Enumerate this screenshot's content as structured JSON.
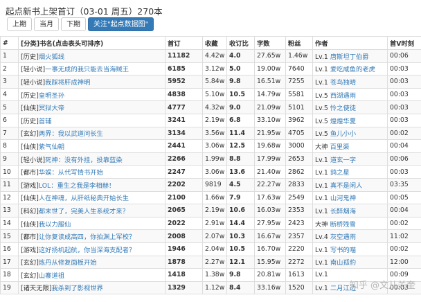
{
  "page": {
    "title": "起点新书上架首订（03-01 周五）270本",
    "buttons": [
      "上期",
      "当月",
      "下期",
      "关注\"起点数据图\""
    ]
  },
  "table": {
    "headers": [
      "#",
      "[分类]书名(点击表头可排序)",
      "首订",
      "收藏",
      "收订比",
      "字数",
      "粉丝",
      "作者",
      "首V时刻"
    ],
    "rows": [
      [
        "1",
        "[历史]",
        "烟火狐线",
        "11182",
        "4.42w",
        "4.0",
        "27.65w",
        "1.46w",
        "Lv.1",
        "唐斯坦丁伯爵",
        "00:06"
      ],
      [
        "2",
        "[轻小说]",
        "一事无成的我只能去当海贼王",
        "6185",
        "3.12w",
        "5.0",
        "19.00w",
        "7640",
        "Lv.1",
        "爱吃咸鱼的老虎",
        "00:03"
      ],
      [
        "3",
        "[轻小说]",
        "我踩将肝成神明",
        "5952",
        "5.84w",
        "9.8",
        "16.51w",
        "7255",
        "Lv.1",
        "苍鸟独晴",
        "00:03"
      ],
      [
        "4",
        "[历史]",
        "皇明圣孙",
        "4838",
        "5.10w",
        "10.5",
        "14.79w",
        "5581",
        "Lv.5",
        "西湖遇雨",
        "00:03"
      ],
      [
        "5",
        "[仙侠]",
        "冥狱大帝",
        "4777",
        "4.32w",
        "9.0",
        "21.09w",
        "5101",
        "Lv.5",
        "怜之使徒",
        "00:03"
      ],
      [
        "6",
        "[历史]",
        "首辅",
        "3241",
        "2.19w",
        "6.8",
        "33.10w",
        "3962",
        "Lv.5",
        "煌煌华夏",
        "00:03"
      ],
      [
        "7",
        "[玄幻]",
        "两界：我以武道问长生",
        "3134",
        "3.56w",
        "11.4",
        "21.95w",
        "4705",
        "Lv.5",
        "鱼儿小小",
        "00:02"
      ],
      [
        "8",
        "[仙侠]",
        "紫气仙朝",
        "2441",
        "3.06w",
        "12.5",
        "19.68w",
        "3000",
        "大神",
        "百里渠",
        "00:04"
      ],
      [
        "9",
        "[轻小说]",
        "死神：没有外挂，投靠蓝染",
        "2266",
        "1.99w",
        "8.8",
        "17.99w",
        "2653",
        "Lv.1",
        "道玄一字",
        "00:06"
      ],
      [
        "10",
        "[都市]",
        "华娱：从代写情书开始",
        "2247",
        "3.06w",
        "13.6",
        "21.40w",
        "2862",
        "Lv.1",
        "鸽之星",
        "00:03"
      ],
      [
        "11",
        "[游戏]",
        "LOL：重生之我是李相赫！",
        "2202",
        "9819",
        "4.5",
        "22.27w",
        "2833",
        "Lv.1",
        "真不是闲人",
        "03:35"
      ],
      [
        "12",
        "[仙侠]",
        "人在神魂，从肝纸秘典开始长生",
        "2100",
        "1.66w",
        "7.9",
        "17.63w",
        "2549",
        "Lv.1",
        "山河鬼神",
        "00:05"
      ],
      [
        "13",
        "[科幻]",
        "都末世了，完美人生系统才来？",
        "2065",
        "2.19w",
        "10.6",
        "16.03w",
        "2353",
        "Lv.1",
        "长醉烟海",
        "00:04"
      ],
      [
        "14",
        "[仙侠]",
        "我以力服仙",
        "2022",
        "2.91w",
        "14.4",
        "27.95w",
        "2423",
        "大神",
        "断桥残雪",
        "00:02"
      ],
      [
        "15",
        "[都市]",
        "让你复读成高四，你拍渊上军校？",
        "2008",
        "2.07w",
        "10.3",
        "16.67w",
        "2357",
        "Lv.4",
        "灰空遇雨",
        "11:02"
      ],
      [
        "16",
        "[游戏]",
        "这好扬机起航，你当深海支配者？",
        "1946",
        "2.04w",
        "10.5",
        "16.70w",
        "2220",
        "Lv.1",
        "写书的喵",
        "00:02"
      ],
      [
        "17",
        "[玄幻]",
        "炼丹从修复面板开始",
        "1878",
        "2.27w",
        "12.1",
        "15.95w",
        "2272",
        "Lv.1",
        "南山孤豹",
        "12:00"
      ],
      [
        "18",
        "[玄幻]",
        "山寨道祖",
        "1418",
        "1.38w",
        "9.8",
        "20.81w",
        "1613",
        "Lv.1",
        "",
        "00:09"
      ],
      [
        "19",
        "[诸天无限]",
        "我杀到了影视世界",
        "1329",
        "1.12w",
        "8.4",
        "33.16w",
        "1520",
        "Lv.1",
        "二月江边",
        "00:03"
      ]
    ]
  },
  "watermark": "知乎 @文儿关奎"
}
